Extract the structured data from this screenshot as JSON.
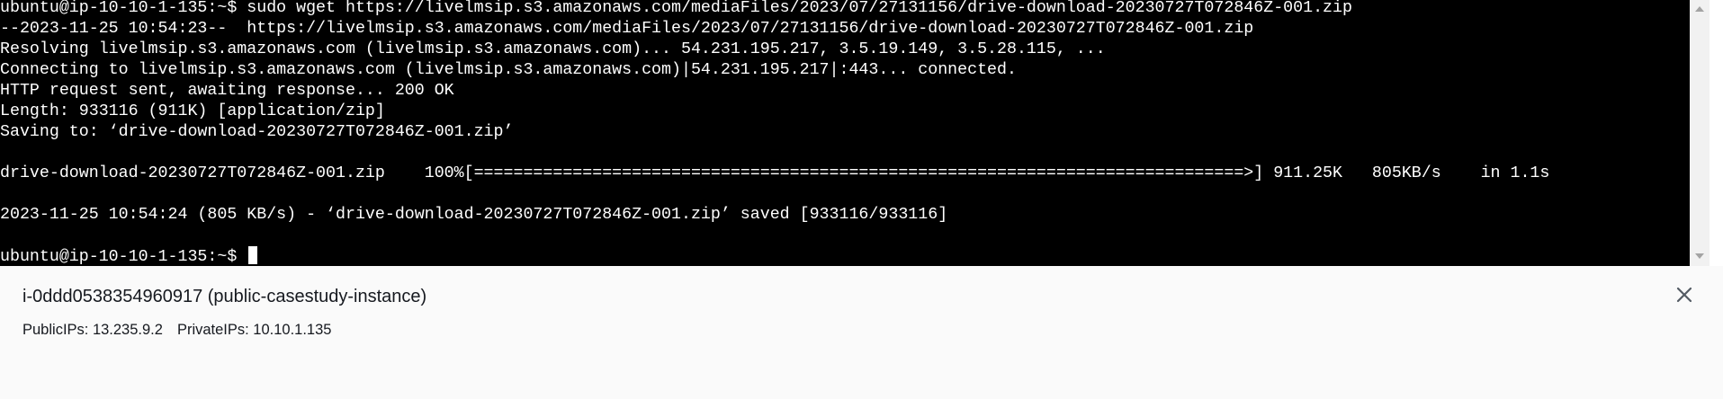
{
  "terminal": {
    "lines": [
      "ubuntu@ip-10-10-1-135:~$ sudo wget https://livelmsip.s3.amazonaws.com/mediaFiles/2023/07/27131156/drive-download-20230727T072846Z-001.zip",
      "--2023-11-25 10:54:23--  https://livelmsip.s3.amazonaws.com/mediaFiles/2023/07/27131156/drive-download-20230727T072846Z-001.zip",
      "Resolving livelmsip.s3.amazonaws.com (livelmsip.s3.amazonaws.com)... 54.231.195.217, 3.5.19.149, 3.5.28.115, ...",
      "Connecting to livelmsip.s3.amazonaws.com (livelmsip.s3.amazonaws.com)|54.231.195.217|:443... connected.",
      "HTTP request sent, awaiting response... 200 OK",
      "Length: 933116 (911K) [application/zip]",
      "Saving to: ‘drive-download-20230727T072846Z-001.zip’",
      "",
      "drive-download-20230727T072846Z-001.zip    100%[==============================================================================>] 911.25K   805KB/s    in 1.1s",
      "",
      "2023-11-25 10:54:24 (805 KB/s) - ‘drive-download-20230727T072846Z-001.zip’ saved [933116/933116]",
      ""
    ],
    "prompt": "ubuntu@ip-10-10-1-135:~$ "
  },
  "instance": {
    "title": "i-0ddd0538354960917 (public-casestudy-instance)",
    "public_ips": "PublicIPs: 13.235.9.2",
    "private_ips": "PrivateIPs: 10.10.1.135"
  },
  "icons": {
    "close": "close-icon",
    "scroll_up": "scroll-up-arrow-icon",
    "scroll_down": "scroll-down-arrow-icon"
  },
  "colors": {
    "terminal_background": "#000000",
    "terminal_text": "#ffffff",
    "panel_background": "#fafafa",
    "panel_text": "#16191f",
    "close_icon": "#545b64"
  }
}
